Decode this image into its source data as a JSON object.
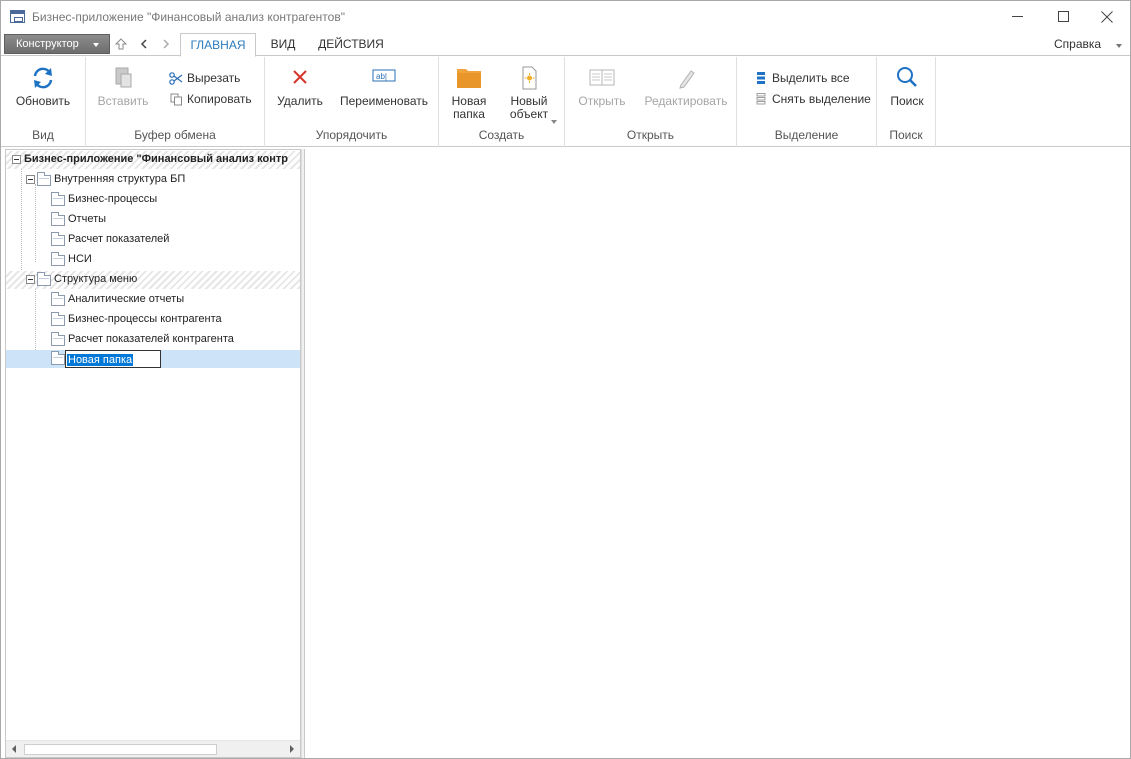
{
  "window": {
    "title": "Бизнес-приложение \"Финансовый анализ контрагентов\""
  },
  "tabbar": {
    "designer_label": "Конструктор",
    "tabs": [
      {
        "label": "ГЛАВНАЯ",
        "active": true
      },
      {
        "label": "ВИД",
        "active": false
      },
      {
        "label": "ДЕЙСТВИЯ",
        "active": false
      }
    ],
    "help_label": "Справка"
  },
  "ribbon": {
    "groups": {
      "view": {
        "label": "Вид",
        "refresh": "Обновить"
      },
      "clipboard": {
        "label": "Буфер обмена",
        "paste": "Вставить",
        "cut": "Вырезать",
        "copy": "Копировать"
      },
      "organize": {
        "label": "Упорядочить",
        "delete": "Удалить",
        "rename": "Переименовать"
      },
      "create": {
        "label": "Создать",
        "new_folder_l1": "Новая",
        "new_folder_l2": "папка",
        "new_object_l1": "Новый",
        "new_object_l2": "объект"
      },
      "open": {
        "label": "Открыть",
        "open": "Открыть",
        "edit": "Редактировать"
      },
      "selection": {
        "label": "Выделение",
        "select_all": "Выделить все",
        "deselect": "Снять выделение"
      },
      "search": {
        "label": "Поиск",
        "search": "Поиск"
      }
    }
  },
  "tree": {
    "root": "Бизнес-приложение \"Финансовый анализ контр",
    "items": [
      {
        "label": "Внутренняя структура БП"
      },
      {
        "label": "Бизнес-процессы"
      },
      {
        "label": "Отчеты"
      },
      {
        "label": "Расчет показателей"
      },
      {
        "label": "НСИ"
      },
      {
        "label": "Структура меню"
      },
      {
        "label": "Аналитические отчеты"
      },
      {
        "label": "Бизнес-процессы контрагента"
      },
      {
        "label": "Расчет показателей контрагента"
      }
    ],
    "rename_value": "Новая папка"
  },
  "colors": {
    "accent": "#2b7bbf",
    "refresh_icon": "#1e72c3",
    "delete_icon": "#d9342b",
    "folder_icon": "#f0a33a",
    "selection": "#cce3f8"
  }
}
